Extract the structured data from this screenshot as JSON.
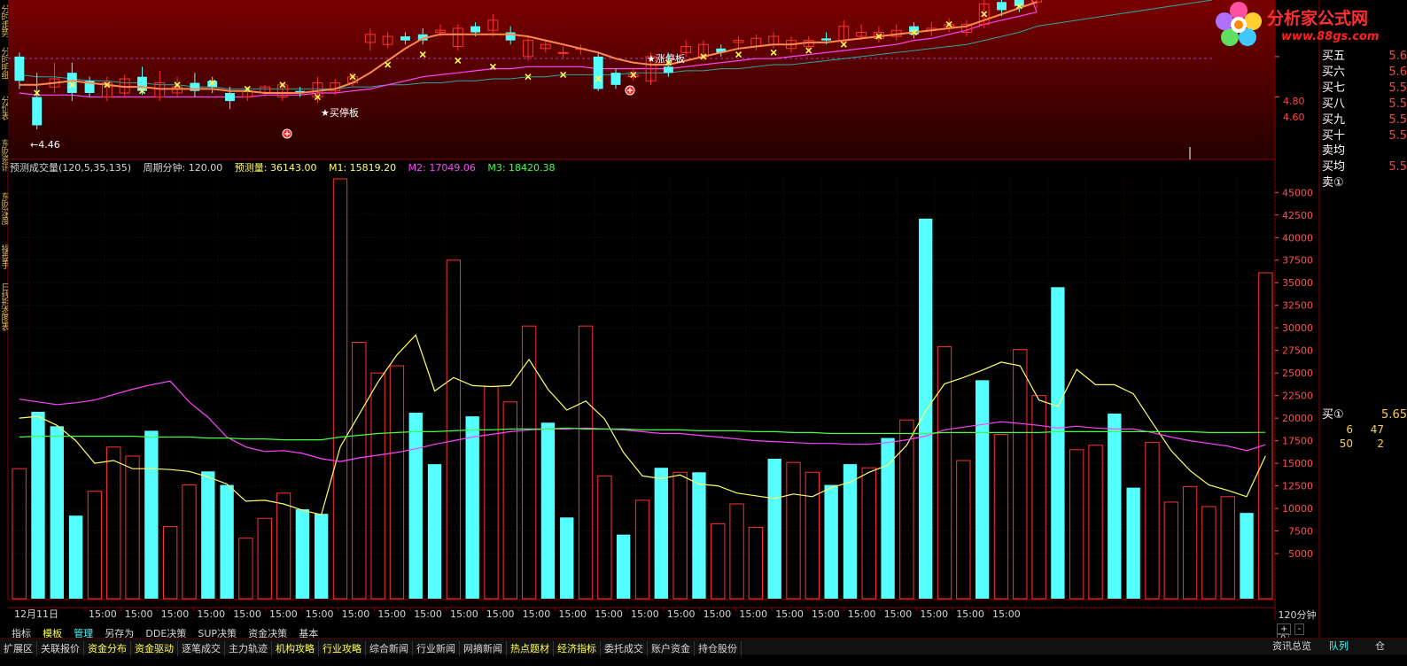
{
  "left_tabs": [
    "分时走势",
    "分时明细",
    "分价表",
    "东财资讯",
    "东财深度",
    "操盘手",
    "日线形态图表"
  ],
  "price_axis": {
    "labels": [
      "4.80",
      "4.60"
    ]
  },
  "annotations": {
    "low_label": "←4.46",
    "limit_up_1": "★买停板",
    "limit_up_2": "★涨停板"
  },
  "volume_title": {
    "name": "预测成交量(120,5,35,135)",
    "period": "周期分钟: 120.00",
    "forecast": "预测量: 36143.00",
    "m1": "M1: 15819.20",
    "m2": "M2: 17049.06",
    "m3": "M3: 18420.38"
  },
  "colors": {
    "bg": "#000000",
    "up": "#ff3030",
    "down": "#55ffff",
    "m1": "#ffff66",
    "m2": "#ff44ff",
    "m3": "#44ff44",
    "grid": "#8b0000",
    "text": "#d6d6d6",
    "accent": "#ff8040"
  },
  "volume_axis": {
    "labels": [
      "45000",
      "42500",
      "40000",
      "37500",
      "35000",
      "32500",
      "30000",
      "27500",
      "25000",
      "22500",
      "20000",
      "17500",
      "15000",
      "12500",
      "10000",
      "7500",
      "5000"
    ]
  },
  "chart_data": {
    "type": "bar",
    "title": "预测成交量(120,5,35,135)",
    "ylim": [
      0,
      46500
    ],
    "values": [
      14400,
      20700,
      19100,
      9200,
      11900,
      16800,
      15800,
      18600,
      8000,
      12600,
      14100,
      12600,
      6700,
      8900,
      11700,
      9900,
      9400,
      46500,
      28400,
      25000,
      25800,
      20600,
      14900,
      37500,
      20200,
      23500,
      21800,
      30200,
      19500,
      9000,
      30200,
      13600,
      7100,
      10900,
      14500,
      14000,
      14000,
      8300,
      10500,
      7900,
      15500,
      15100,
      14000,
      12600,
      14900,
      14500,
      17800,
      19800,
      42100,
      27900,
      15300,
      24200,
      18200,
      27600,
      22500,
      34500,
      16500,
      17000,
      20500,
      12300,
      17300,
      10700,
      12400,
      10200,
      11300,
      9500,
      36100
    ],
    "up_down": "uddduuuduudduuudduuuudduduuudduudududuuuduuddududuuduuuduudduuuuuduuud",
    "series": [
      {
        "name": "M1",
        "values": [
          20000,
          20200,
          19200,
          17500,
          15000,
          15300,
          14400,
          14400,
          14300,
          14100,
          13500,
          12700,
          10800,
          10900,
          10500,
          9800,
          9300,
          16800,
          20400,
          24000,
          27000,
          29200,
          23000,
          24500,
          23600,
          23500,
          23600,
          26500,
          23200,
          20900,
          21900,
          19900,
          16200,
          13600,
          13300,
          13700,
          12700,
          12500,
          11700,
          11400,
          11100,
          11600,
          11300,
          12300,
          12900,
          14000,
          14800,
          17000,
          20800,
          23800,
          24500,
          25300,
          26200,
          25800,
          22000,
          21300,
          25400,
          23700,
          23700,
          22700,
          19500,
          16400,
          14200,
          12600,
          12000,
          11300,
          15800
        ]
      },
      {
        "name": "M2",
        "values": [
          22100,
          21800,
          21500,
          21700,
          22000,
          22600,
          23200,
          23700,
          24100,
          21800,
          20100,
          17900,
          16800,
          16300,
          16400,
          16100,
          15500,
          15200,
          15600,
          15900,
          16200,
          16600,
          17100,
          17500,
          17900,
          18200,
          18500,
          18700,
          18800,
          18800,
          18900,
          18800,
          18700,
          18500,
          18300,
          18300,
          18100,
          17900,
          17700,
          17500,
          17400,
          17300,
          17200,
          17200,
          17100,
          17100,
          17300,
          17600,
          18000,
          18700,
          19000,
          19300,
          19600,
          19400,
          19200,
          18900,
          19100,
          18900,
          18800,
          18800,
          18400,
          17900,
          17500,
          17200,
          16900,
          16400,
          17049
        ]
      },
      {
        "name": "M3",
        "values": [
          17900,
          18000,
          18000,
          18000,
          18000,
          18000,
          18000,
          17900,
          17900,
          17900,
          17800,
          17800,
          17700,
          17700,
          17600,
          17600,
          17600,
          17900,
          18100,
          18300,
          18400,
          18500,
          18500,
          18600,
          18700,
          18700,
          18800,
          18800,
          18800,
          18900,
          18800,
          18800,
          18800,
          18700,
          18700,
          18700,
          18600,
          18600,
          18600,
          18500,
          18500,
          18400,
          18400,
          18300,
          18300,
          18300,
          18300,
          18300,
          18300,
          18400,
          18400,
          18400,
          18400,
          18400,
          18400,
          18500,
          18500,
          18500,
          18500,
          18500,
          18500,
          18500,
          18500,
          18400,
          18400,
          18400,
          18420
        ]
      }
    ]
  },
  "price_chart": {
    "ylim": [
      4.3,
      5.08
    ],
    "open": [
      4.8,
      4.6,
      4.65,
      4.72,
      4.68,
      4.6,
      4.62,
      4.7,
      4.6,
      4.62,
      4.67,
      4.68,
      4.62,
      4.6,
      4.62,
      4.6,
      4.63,
      4.6,
      4.63,
      4.67,
      4.87,
      4.86,
      4.9,
      4.91,
      4.92,
      4.85,
      4.95,
      4.93,
      4.92,
      4.8,
      4.84,
      4.82,
      4.84,
      4.8,
      4.72,
      4.7,
      4.68,
      4.75,
      4.82,
      4.8,
      4.84,
      4.87,
      4.85,
      4.86,
      4.84,
      4.85,
      4.89,
      4.88,
      4.9,
      4.89,
      4.9,
      4.95,
      4.93,
      4.95,
      4.92,
      4.96,
      5.07,
      5.08,
      5.07
    ],
    "close": [
      4.68,
      4.46,
      4.69,
      4.62,
      4.62,
      4.67,
      4.69,
      4.63,
      4.67,
      4.65,
      4.63,
      4.65,
      4.58,
      4.63,
      4.65,
      4.66,
      4.62,
      4.67,
      4.67,
      4.7,
      4.91,
      4.9,
      4.88,
      4.88,
      4.93,
      4.94,
      4.92,
      4.98,
      4.88,
      4.88,
      4.86,
      4.82,
      4.84,
      4.64,
      4.66,
      4.71,
      4.8,
      4.72,
      4.85,
      4.86,
      4.82,
      4.88,
      4.89,
      4.9,
      4.88,
      4.88,
      4.88,
      4.95,
      4.92,
      4.92,
      4.93,
      4.91,
      4.94,
      4.96,
      4.96,
      5.06,
      5.03,
      5.05,
      5.1
    ],
    "high": [
      4.82,
      4.72,
      4.77,
      4.77,
      4.7,
      4.7,
      4.71,
      4.75,
      4.73,
      4.7,
      4.72,
      4.7,
      4.65,
      4.65,
      4.66,
      4.67,
      4.65,
      4.7,
      4.69,
      4.72,
      4.94,
      4.92,
      4.92,
      4.94,
      4.96,
      4.96,
      4.97,
      5.01,
      4.95,
      4.9,
      4.88,
      4.85,
      4.86,
      4.82,
      4.74,
      4.74,
      4.82,
      4.82,
      4.88,
      4.88,
      4.86,
      4.9,
      4.91,
      4.92,
      4.9,
      4.9,
      4.92,
      4.98,
      4.96,
      4.95,
      4.96,
      4.97,
      4.97,
      4.99,
      4.98,
      5.08,
      5.1,
      5.1,
      5.12
    ],
    "low": [
      4.64,
      4.44,
      4.62,
      4.58,
      4.6,
      4.58,
      4.6,
      4.61,
      4.58,
      4.6,
      4.6,
      4.62,
      4.54,
      4.58,
      4.6,
      4.58,
      4.6,
      4.57,
      4.61,
      4.65,
      4.83,
      4.84,
      4.86,
      4.86,
      4.9,
      4.83,
      4.9,
      4.9,
      4.86,
      4.78,
      4.82,
      4.79,
      4.81,
      4.63,
      4.64,
      4.68,
      4.66,
      4.7,
      4.8,
      4.78,
      4.8,
      4.84,
      4.83,
      4.84,
      4.82,
      4.83,
      4.86,
      4.86,
      4.88,
      4.87,
      4.88,
      4.89,
      4.9,
      4.92,
      4.9,
      4.94,
      5.0,
      5.02,
      5.04
    ],
    "ma_orange": [
      4.66,
      4.66,
      4.67,
      4.68,
      4.67,
      4.66,
      4.65,
      4.65,
      4.64,
      4.64,
      4.64,
      4.64,
      4.63,
      4.63,
      4.62,
      4.62,
      4.62,
      4.63,
      4.64,
      4.67,
      4.72,
      4.78,
      4.84,
      4.89,
      4.91,
      4.91,
      4.91,
      4.91,
      4.91,
      4.9,
      4.88,
      4.86,
      4.84,
      4.82,
      4.79,
      4.77,
      4.76,
      4.76,
      4.78,
      4.8,
      4.82,
      4.84,
      4.85,
      4.86,
      4.86,
      4.87,
      4.87,
      4.88,
      4.89,
      4.9,
      4.91,
      4.92,
      4.93,
      4.94,
      4.95,
      4.98,
      5.01,
      5.04,
      5.07
    ],
    "ma_magenta": [
      4.62,
      4.61,
      4.61,
      4.61,
      4.6,
      4.6,
      4.6,
      4.6,
      4.6,
      4.6,
      4.6,
      4.6,
      4.6,
      4.6,
      4.61,
      4.61,
      4.61,
      4.62,
      4.62,
      4.63,
      4.64,
      4.66,
      4.68,
      4.7,
      4.71,
      4.72,
      4.73,
      4.74,
      4.74,
      4.75,
      4.75,
      4.75,
      4.75,
      4.74,
      4.74,
      4.74,
      4.74,
      4.74,
      4.75,
      4.76,
      4.77,
      4.78,
      4.79,
      4.79,
      4.8,
      4.81,
      4.82,
      4.83,
      4.84,
      4.85,
      4.86,
      4.88,
      4.89,
      4.91,
      4.93,
      4.96,
      4.98,
      5.0,
      5.02
    ],
    "ma_teal": [
      4.71,
      4.7,
      4.7,
      4.69,
      4.68,
      4.68,
      4.67,
      4.67,
      4.66,
      4.66,
      4.65,
      4.65,
      4.64,
      4.64,
      4.64,
      4.64,
      4.64,
      4.64,
      4.64,
      4.65,
      4.65,
      4.66,
      4.66,
      4.67,
      4.67,
      4.68,
      4.68,
      4.69,
      4.69,
      4.7,
      4.7,
      4.71,
      4.71,
      4.71,
      4.71,
      4.72,
      4.72,
      4.72,
      4.73,
      4.73,
      4.74,
      4.74,
      4.75,
      4.76,
      4.76,
      4.77,
      4.78,
      4.79,
      4.8,
      4.81,
      4.82,
      4.83,
      4.84,
      4.85,
      4.86,
      4.88,
      4.9,
      4.92,
      4.95
    ],
    "sar": [
      4.62,
      4.62,
      4.64,
      4.66,
      4.68,
      4.66,
      4.63,
      4.63,
      4.67,
      4.66,
      4.66,
      4.67,
      4.65,
      4.64,
      4.64,
      4.66,
      4.65,
      4.6,
      4.64,
      4.7,
      4.73,
      4.76,
      4.79,
      4.81,
      4.82,
      4.78,
      4.76,
      4.75,
      4.73,
      4.7,
      4.71,
      4.71,
      4.7,
      4.69,
      4.69,
      4.71,
      4.74,
      4.77,
      4.79,
      4.8,
      4.81,
      4.81,
      4.82,
      4.82,
      4.82,
      4.83,
      4.84,
      4.86,
      4.88,
      4.9,
      4.91,
      4.92,
      4.94,
      4.96,
      4.98,
      5.01,
      5.03,
      5.05,
      5.08
    ]
  },
  "x_axis": {
    "first": "12月11日",
    "tick": "15:00",
    "period_label": "120分钟"
  },
  "toolbar1": [
    "指标",
    "模板",
    "管理",
    "另存为",
    "DDE决策",
    "SUP决策",
    "资金决策",
    "基本"
  ],
  "toolbar2": [
    {
      "label": "扩展区",
      "color": "#d6d6d6"
    },
    {
      "label": "关联报价",
      "color": "#d6d6d6"
    },
    {
      "label": "资金分布",
      "color": "#ffff44"
    },
    {
      "label": "资金驱动",
      "color": "#ffff44"
    },
    {
      "label": "逐笔成交",
      "color": "#d6d6d6"
    },
    {
      "label": "主力轨迹",
      "color": "#d6d6d6"
    },
    {
      "label": "机构攻略",
      "color": "#ffff44"
    },
    {
      "label": "行业攻略",
      "color": "#ffff44"
    },
    {
      "label": "综合新闻",
      "color": "#d6d6d6"
    },
    {
      "label": "行业新闻",
      "color": "#d6d6d6"
    },
    {
      "label": "网摘新闻",
      "color": "#d6d6d6"
    },
    {
      "label": "热点题材",
      "color": "#ffff44"
    },
    {
      "label": "经济指标",
      "color": "#ffff44"
    },
    {
      "label": "委托成交",
      "color": "#d6d6d6"
    },
    {
      "label": "账户资金",
      "color": "#d6d6d6"
    },
    {
      "label": "持仓股份",
      "color": "#d6d6d6"
    }
  ],
  "right_panel": {
    "rows": [
      {
        "label": "买五",
        "value": "5.6"
      },
      {
        "label": "买六",
        "value": "5.6"
      },
      {
        "label": "买七",
        "value": "5.5"
      },
      {
        "label": "买八",
        "value": "5.5"
      },
      {
        "label": "买九",
        "value": "5.5"
      },
      {
        "label": "买十",
        "value": "5.5"
      }
    ],
    "sell_avg": "卖均",
    "buy_avg": "买均",
    "buy_avg_value": "5.5",
    "sell1": "卖①",
    "buy1": "买①",
    "buy1_value": "5.65",
    "q1a": "6",
    "q1b": "47",
    "q2a": "50",
    "q2b": "2"
  },
  "bottom_right": {
    "news": "资讯总览",
    "queue": "队列",
    "pos": "仓"
  },
  "logo": {
    "text": "分析家公式网",
    "url": "www.88gs.com"
  }
}
